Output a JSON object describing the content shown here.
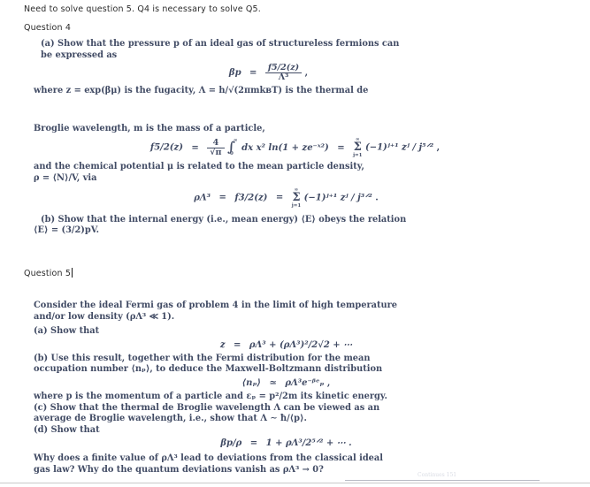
{
  "prompt": {
    "text": "Need to solve question 5. Q4 is necessary to solve Q5."
  },
  "labels": {
    "question4": "Question 4",
    "question5": "Question 5"
  },
  "question4": {
    "part_a_line1": "(a) Show that the pressure p of an ideal gas of structureless fermions can",
    "part_a_line2": "be expressed as",
    "eq_bp_lhs": "βp",
    "eq_bp_rel": "=",
    "eq_bp_num": "f5/2(z)",
    "eq_bp_den": "Λ³",
    "eq_bp_trail": ",",
    "line_where": "where z = exp(βμ) is the fugacity, Λ = h/√(2πmkʙT) is the thermal de",
    "line_broglie": "Broglie wavelength, m is the mass of a particle,",
    "eq_f52_lhs": "f5/2(z)",
    "eq_f52_frac_num": "4",
    "eq_f52_frac_den": "√π",
    "eq_f52_int_top": "∞",
    "eq_f52_int_bot": "0",
    "eq_f52_integrand": "dx x² ln(1 + ze⁻ˣ²)",
    "eq_f52_sum_top": "∞",
    "eq_f52_sum_bot": "j=1",
    "eq_f52_series": "(−1)ʲ⁺¹ zʲ / j⁵ᐟ²",
    "eq_f52_trail": ",",
    "line_chem1": "and the chemical potential μ is related to the mean particle density,",
    "line_chem2": "ρ = ⟨N⟩/V, via",
    "eq_rho_lhs": "ρΛ³",
    "eq_rho_mid": "f3/2(z)",
    "eq_rho_sum_top": "∞",
    "eq_rho_sum_bot": "j=1",
    "eq_rho_series": "(−1)ʲ⁺¹ zʲ / j³ᐟ²",
    "eq_rho_trail": ".",
    "part_b_line1": "(b) Show that the internal energy (i.e., mean energy) ⟨E⟩ obeys the relation",
    "part_b_line2": "⟨E⟩ = (3/2)pV."
  },
  "question5": {
    "intro_line1": "Consider the ideal Fermi gas of problem 4 in the limit of high temperature",
    "intro_line2": "and/or low density (ρΛ³ ≪ 1).",
    "part_a": "(a) Show that",
    "eq_z_lhs": "z",
    "eq_z_rhs": "ρΛ³ + (ρΛ³)²/2√2 + ⋯",
    "part_b_line1": "(b) Use this result, together with the Fermi distribution for the mean",
    "part_b_line2": "occupation number ⟨nₚ⟩, to deduce the Maxwell-Boltzmann distribution",
    "eq_np_lhs": "⟨nₚ⟩",
    "eq_np_rel": "≃",
    "eq_np_rhs": "ρΛ³e⁻ᵝᵉₚ",
    "eq_np_trail": ",",
    "line_where_p": "where p is the momentum of a particle and εₚ = p²/2m its kinetic energy.",
    "part_c_line1": "(c) Show that the thermal de Broglie wavelength Λ can be viewed as an",
    "part_c_line2": "average de Broglie wavelength, i.e., show that Λ ∼ ħ/⟨p⟩.",
    "part_d": "(d) Show that",
    "eq_bpr_lhs": "βp/ρ",
    "eq_bpr_rhs": "1 + ρΛ³/2⁵ᐟ² + ⋯ .",
    "closing_line1": "Why does a finite value of ρΛ³ lead to deviations from the classical ideal",
    "closing_line2": "gas law? Why do the quantum deviations vanish as ρΛ³ → 0?"
  },
  "footer": {
    "page_note": "Continues 151"
  },
  "colors": {
    "ui_text": "#2b2b2b",
    "scan_text": "#414b64",
    "background": "#ffffff",
    "caret": "#1a1a1a"
  }
}
